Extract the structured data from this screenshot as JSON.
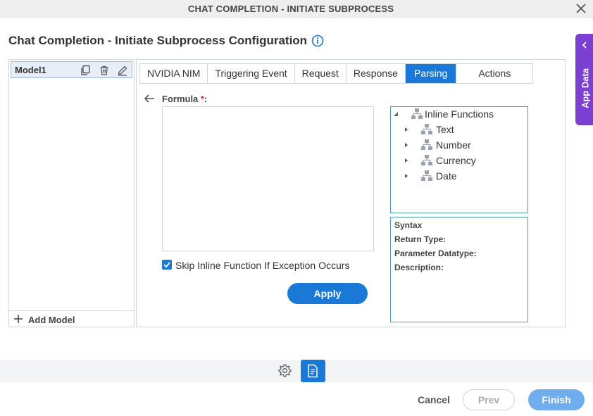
{
  "window": {
    "title": "CHAT COMPLETION - INITIATE SUBPROCESS",
    "close_icon": "close-icon"
  },
  "header": {
    "title": "Chat Completion - Initiate Subprocess Configuration",
    "info_icon": "info-icon"
  },
  "app_data": {
    "label": "App Data",
    "icon": "chevron-left-icon",
    "color": "#7b3fd1"
  },
  "models": {
    "items": [
      {
        "name": "Model1",
        "icons": [
          "copy-icon",
          "trash-icon",
          "edit-icon"
        ]
      }
    ],
    "add_label": "Add Model"
  },
  "tabs": [
    {
      "label": "NVIDIA NIM",
      "active": false
    },
    {
      "label": "Triggering Event",
      "active": false
    },
    {
      "label": "Request",
      "active": false
    },
    {
      "label": "Response",
      "active": false
    },
    {
      "label": "Parsing",
      "active": true
    },
    {
      "label": "Actions",
      "active": false
    }
  ],
  "formula": {
    "label": "Formula",
    "required_mark": "*",
    "suffix": ":",
    "value": "",
    "skip_label": "Skip Inline Function If Exception Occurs",
    "skip_checked": true,
    "apply_label": "Apply"
  },
  "tree": {
    "root": "Inline Functions",
    "children": [
      "Text",
      "Number",
      "Currency",
      "Date"
    ]
  },
  "syntax": {
    "syntax_label": "Syntax",
    "return_type_label": "Return Type:",
    "parameter_label": "Parameter Datatype:",
    "description_label": "Description:"
  },
  "footer": {
    "cancel": "Cancel",
    "prev": "Prev",
    "finish": "Finish"
  },
  "colors": {
    "primary": "#1a78d6",
    "finish_disabled": "#6fadec",
    "required": "#d9342b",
    "panel_border": "#4aa3a6"
  }
}
